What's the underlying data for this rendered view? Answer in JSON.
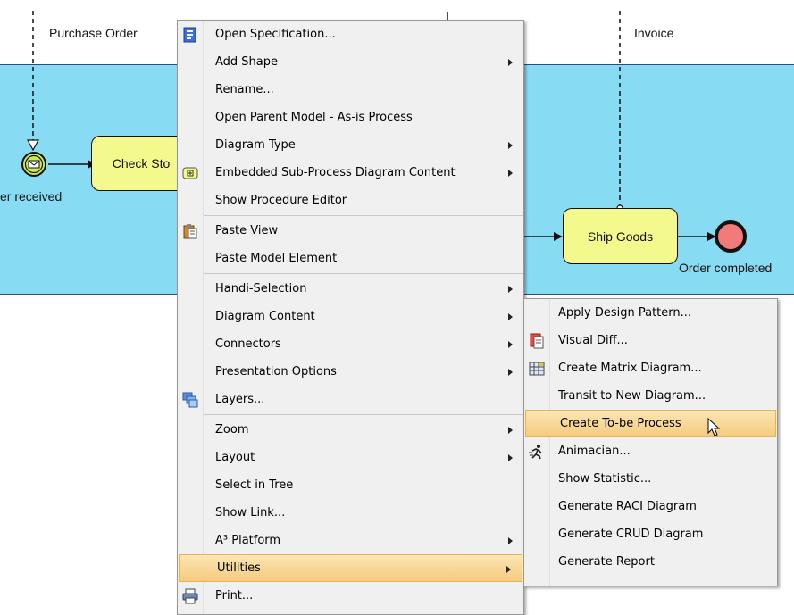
{
  "diagram": {
    "lanes": [
      "Purchase Order",
      "Invoice"
    ],
    "tasks": {
      "check_stock": "Check Sto",
      "ship_goods": "Ship Goods"
    },
    "events": {
      "start": "er received",
      "end": "Order completed"
    }
  },
  "context_menu": {
    "items": [
      {
        "label": "Open Specification...",
        "icon": "specification-icon",
        "submenu": false
      },
      {
        "label": "Add Shape",
        "submenu": true
      },
      {
        "label": "Rename...",
        "submenu": false
      },
      {
        "label": "Open Parent Model - As-is Process",
        "submenu": false
      },
      {
        "label": "Diagram Type",
        "submenu": true
      },
      {
        "label": "Embedded Sub-Process Diagram Content",
        "icon": "sub-process-icon",
        "submenu": true
      },
      {
        "label": "Show Procedure Editor",
        "submenu": false
      },
      {
        "label": "Paste View",
        "icon": "clipboard-icon",
        "submenu": false
      },
      {
        "label": "Paste Model Element",
        "submenu": false
      },
      {
        "label": "Handi-Selection",
        "submenu": true
      },
      {
        "label": "Diagram Content",
        "submenu": true
      },
      {
        "label": "Connectors",
        "submenu": true
      },
      {
        "label": "Presentation Options",
        "submenu": true
      },
      {
        "label": "Layers...",
        "icon": "layers-icon",
        "submenu": false
      },
      {
        "label": "Zoom",
        "submenu": true
      },
      {
        "label": "Layout",
        "submenu": true
      },
      {
        "label": "Select in Tree",
        "submenu": false
      },
      {
        "label": "Show Link...",
        "submenu": false
      },
      {
        "label": "A³ Platform",
        "submenu": true
      },
      {
        "label": "Utilities",
        "submenu": true,
        "highlighted": true
      },
      {
        "label": "Print...",
        "icon": "printer-icon",
        "submenu": false
      }
    ]
  },
  "utilities_submenu": {
    "items": [
      {
        "label": "Apply Design Pattern..."
      },
      {
        "label": "Visual Diff...",
        "icon": "visual-diff-icon"
      },
      {
        "label": "Create Matrix Diagram...",
        "icon": "matrix-icon"
      },
      {
        "label": "Transit to New Diagram..."
      },
      {
        "label": "Create To-be Process",
        "highlighted": true
      },
      {
        "label": "Animacian...",
        "icon": "running-man-icon"
      },
      {
        "label": "Show Statistic..."
      },
      {
        "label": "Generate RACI Diagram"
      },
      {
        "label": "Generate CRUD Diagram"
      },
      {
        "label": "Generate Report"
      }
    ]
  }
}
